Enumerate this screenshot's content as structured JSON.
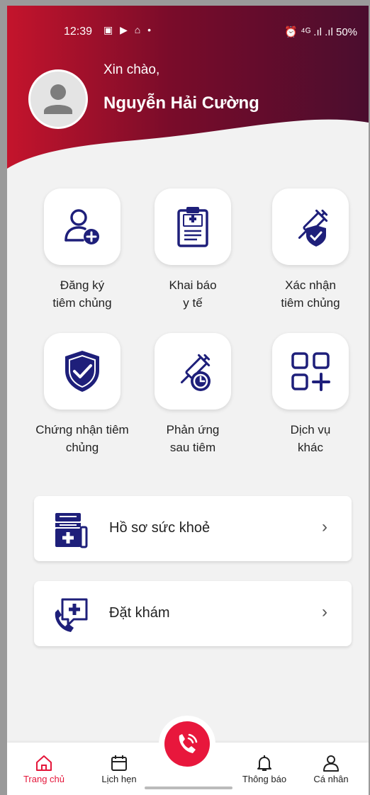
{
  "status_bar": {
    "time": "12:39",
    "notif_icons": "▣ ▶ ⌂ •",
    "right": "⏰ ⁴ᴳ .ıl .ıl 50%"
  },
  "header": {
    "greeting": "Xin chào,",
    "user_name": "Nguyễn Hải Cường"
  },
  "services": [
    {
      "label": "Đăng ký\ntiêm chủng",
      "icon": "add-user-icon"
    },
    {
      "label": "Khai báo\ny tế",
      "icon": "medical-clipboard-icon"
    },
    {
      "label": "Xác nhận\ntiêm chủng",
      "icon": "syringe-shield-icon"
    },
    {
      "label": "Chứng nhận tiêm\nchủng",
      "icon": "shield-check-icon"
    },
    {
      "label": "Phản ứng\nsau tiêm",
      "icon": "syringe-clock-icon"
    },
    {
      "label": "Dịch vụ\nkhác",
      "icon": "grid-plus-icon"
    }
  ],
  "cards": [
    {
      "label": "Hồ sơ sức khoẻ",
      "icon": "health-record-icon"
    },
    {
      "label": "Đặt khám",
      "icon": "booking-call-icon"
    }
  ],
  "bottom_nav": {
    "home": "Trang chủ",
    "schedule": "Lịch hẹn",
    "notifications": "Thông báo",
    "profile": "Cá nhân"
  },
  "colors": {
    "primary": "#e8173c",
    "icon_navy": "#1e1f7a",
    "header_dark": "#6a0b22"
  }
}
